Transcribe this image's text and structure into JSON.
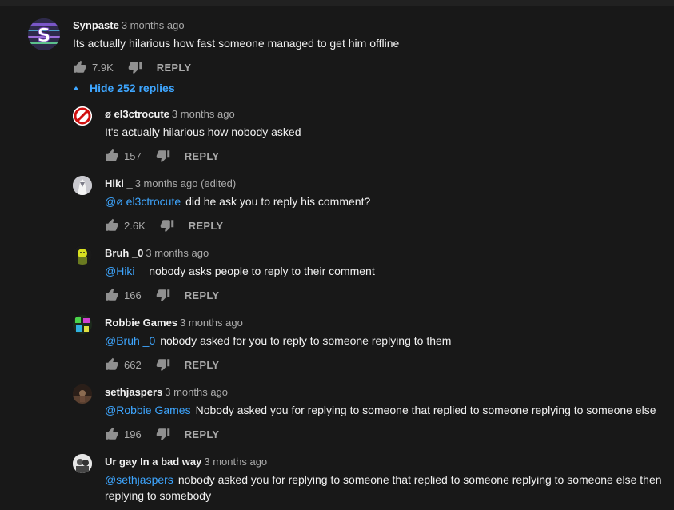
{
  "comment": {
    "author": "Synpaste",
    "time": "3 months ago",
    "text": "Its actually hilarious how fast someone managed to get him offline",
    "likes": "7.9K",
    "reply_label": "REPLY"
  },
  "hide_replies_label": "Hide 252 replies",
  "replies": [
    {
      "author": "ø el3ctrocute",
      "time": "3 months ago",
      "mention": "",
      "text": "It's actually hilarious how nobody asked",
      "likes": "157",
      "reply_label": "REPLY"
    },
    {
      "author": "Hiki _",
      "time": "3 months ago (edited)",
      "mention": "@ø el3ctrocute",
      "text": "did he ask you to reply his comment?",
      "likes": "2.6K",
      "reply_label": "REPLY"
    },
    {
      "author": "Bruh _0",
      "time": "3 months ago",
      "mention": "@Hiki _",
      "text": "nobody asks people to reply to their comment",
      "likes": "166",
      "reply_label": "REPLY"
    },
    {
      "author": "Robbie Games",
      "time": "3 months ago",
      "mention": "@Bruh _0",
      "text": "nobody asked for you to reply to someone replying to them",
      "likes": "662",
      "reply_label": "REPLY"
    },
    {
      "author": "sethjaspers",
      "time": "3 months ago",
      "mention": "@Robbie Games",
      "text": "Nobody asked you for replying to someone that replied to someone replying to someone else",
      "likes": "196",
      "reply_label": "REPLY"
    },
    {
      "author": "Ur gay In a bad way",
      "time": "3 months ago",
      "mention": "@sethjaspers",
      "text": "nobody asked you for replying to someone that replied to someone replying to someone else then replying to somebody"
    }
  ],
  "icons": {
    "like": "thumbs-up-icon",
    "dislike": "thumbs-down-icon",
    "collapse": "caret-up-icon"
  },
  "colors": {
    "background": "#181818",
    "link": "#3ea6ff",
    "secondary_text": "#aaaaaa"
  }
}
